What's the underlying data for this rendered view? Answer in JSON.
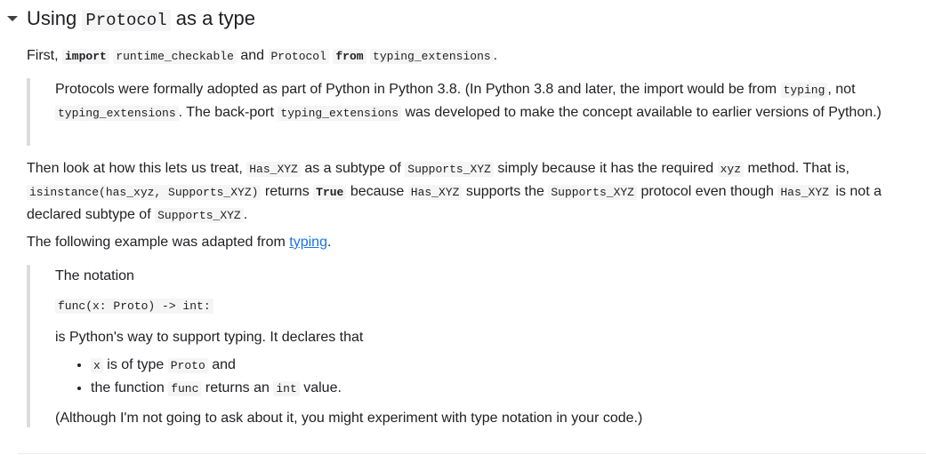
{
  "section": {
    "title_prefix": "Using",
    "title_code": "Protocol",
    "title_suffix": "as a type"
  },
  "para1": {
    "t1": "First,",
    "c1": "import",
    "c2": "runtime_checkable",
    "t2": "and",
    "c3": "Protocol",
    "c4": "from",
    "c5": "typing_extensions",
    "t3": "."
  },
  "quote1": {
    "t1": "Protocols were formally adopted as part of Python in Python 3.8. (In Python 3.8 and later, the import would be from",
    "c1": "typing",
    "t2": ", not",
    "c2": "typing_extensions",
    "t3": ". The back-port",
    "c3": "typing_extensions",
    "t4": "was developed to make the concept available to earlier versions of Python.)"
  },
  "para2": {
    "t1": "Then look at how this lets us treat,",
    "c1": "Has_XYZ",
    "t2": "as a subtype of",
    "c2": "Supports_XYZ",
    "t3": "simply because it has the required",
    "c3": "xyz",
    "t4": "method. That is,",
    "c4": "isinstance(has_xyz, Supports_XYZ)",
    "t5": "returns",
    "c5": "True",
    "t6": "because",
    "c6": "Has_XYZ",
    "t7": "supports the",
    "c7": "Supports_XYZ",
    "t8": "protocol even though",
    "c8": "Has_XYZ",
    "t9": "is not a declared subtype of",
    "c9": "Supports_XYZ",
    "t10": "."
  },
  "para3": {
    "t1": "The following example was adapted from",
    "link": "typing",
    "t2": "."
  },
  "quote2": {
    "notation": "The notation",
    "code": "func(x: Proto) -> int:",
    "declares": "is Python's way to support typing. It declares that",
    "bullet1": {
      "c1": "x",
      "t1": "is of type",
      "c2": "Proto",
      "t2": "and"
    },
    "bullet2": {
      "t1": "the function",
      "c1": "func",
      "t2": "returns an",
      "c2": "int",
      "t3": "value."
    },
    "closing": "(Although I'm not going to ask about it, you might experiment with type notation in your code.)"
  }
}
